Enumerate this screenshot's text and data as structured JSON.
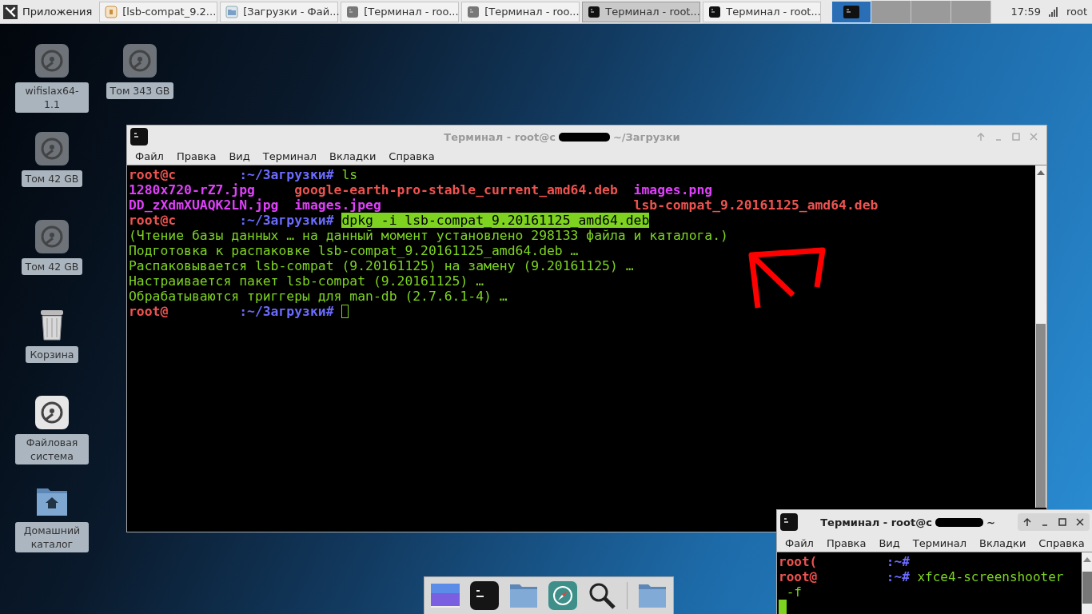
{
  "taskbar": {
    "apps_menu": "Приложения",
    "tasks": [
      {
        "label": "[lsb-compat_9.2...",
        "kind": "package",
        "selected": false
      },
      {
        "label": "[Загрузки - Фай...",
        "kind": "folder",
        "selected": false
      },
      {
        "label": "[Терминал - roo...",
        "kind": "terminal_dim",
        "selected": false
      },
      {
        "label": "[Терминал - roo...",
        "kind": "terminal_dim",
        "selected": false
      },
      {
        "label": "Терминал - root...",
        "kind": "terminal",
        "selected": true
      },
      {
        "label": "Терминал - root...",
        "kind": "terminal",
        "selected": false
      }
    ],
    "workspaces": [
      {
        "selected": true
      },
      {
        "selected": false
      },
      {
        "selected": false
      },
      {
        "selected": false
      }
    ],
    "clock": "17:59",
    "user": "root"
  },
  "desktop_icons": [
    {
      "label": "wifislax64-1.1",
      "kind": "drive"
    },
    {
      "label": "Том 343 GB",
      "kind": "drive"
    },
    {
      "label": "Том 42 GB",
      "kind": "drive"
    },
    {
      "label": "Том 42 GB",
      "kind": "drive"
    },
    {
      "label": "Корзина",
      "kind": "trash"
    },
    {
      "label": "Файловая система",
      "kind": "system_drive"
    },
    {
      "label": "Домашний каталог",
      "kind": "home"
    }
  ],
  "main_terminal": {
    "title": "Терминал - root@c",
    "title_path": "~/Загрузки",
    "menu": [
      "Файл",
      "Правка",
      "Вид",
      "Терминал",
      "Вкладки",
      "Справка"
    ],
    "lines": [
      [
        {
          "kind": "user",
          "text": "root@c"
        },
        {
          "kind": "path",
          "text": ":~/Загрузки#"
        },
        {
          "kind": "command",
          "text": "ls"
        }
      ],
      [
        {
          "kind": "file_image",
          "text": "1280x720-rZ7.jpg"
        },
        {
          "kind": "file_deb",
          "text": "google-earth-pro-stable_current_amd64.deb"
        },
        {
          "kind": "file_image",
          "text": "images.png"
        }
      ],
      [
        {
          "kind": "file_image",
          "text": "DD_zXdmXUAQK2LN.jpg"
        },
        {
          "kind": "file_image",
          "text": "images.jpeg"
        },
        {
          "kind": "file_deb",
          "text": "lsb-compat_9.20161125_amd64.deb"
        }
      ],
      [
        {
          "kind": "user",
          "text": "root@c"
        },
        {
          "kind": "path",
          "text": ":~/Загрузки#"
        },
        {
          "kind": "selected_command",
          "text": "dpkg -i lsb-compat_9.20161125_amd64.deb"
        }
      ],
      [
        {
          "kind": "output",
          "text": "(Чтение базы данных … на данный момент установлено 298133 файла и каталога.)"
        }
      ],
      [
        {
          "kind": "output",
          "text": "Подготовка к распаковке lsb-compat_9.20161125_amd64.deb …"
        }
      ],
      [
        {
          "kind": "output",
          "text": "Распаковывается lsb-compat (9.20161125) на замену (9.20161125) …"
        }
      ],
      [
        {
          "kind": "output",
          "text": "Настраивается пакет lsb-compat (9.20161125) …"
        }
      ],
      [
        {
          "kind": "output",
          "text": "Обрабатываются триггеры для man-db (2.7.6.1-4) …"
        }
      ],
      [
        {
          "kind": "user",
          "text": "root@"
        },
        {
          "kind": "path",
          "text": ":~/Загрузки#"
        },
        {
          "kind": "cursor_outline"
        }
      ]
    ]
  },
  "small_terminal": {
    "title": "Терминал - root@c",
    "title_path": "~",
    "menu": [
      "Файл",
      "Правка",
      "Вид",
      "Терминал",
      "Вкладки",
      "Справка"
    ],
    "lines": [
      [
        {
          "kind": "user",
          "text": "root("
        },
        {
          "kind": "path",
          "text": ":~#"
        }
      ],
      [
        {
          "kind": "user",
          "text": "root@"
        },
        {
          "kind": "path",
          "text": ":~#"
        },
        {
          "kind": "command",
          "text": "xfce4-screenshooter"
        }
      ],
      [
        {
          "kind": "command",
          "text": "-f"
        }
      ],
      [
        {
          "kind": "cursor_block"
        }
      ]
    ]
  },
  "dock": [
    {
      "kind": "screenshot"
    },
    {
      "kind": "terminal"
    },
    {
      "kind": "folder"
    },
    {
      "kind": "compass"
    },
    {
      "kind": "search"
    },
    {
      "kind": "separator"
    },
    {
      "kind": "folder"
    }
  ]
}
